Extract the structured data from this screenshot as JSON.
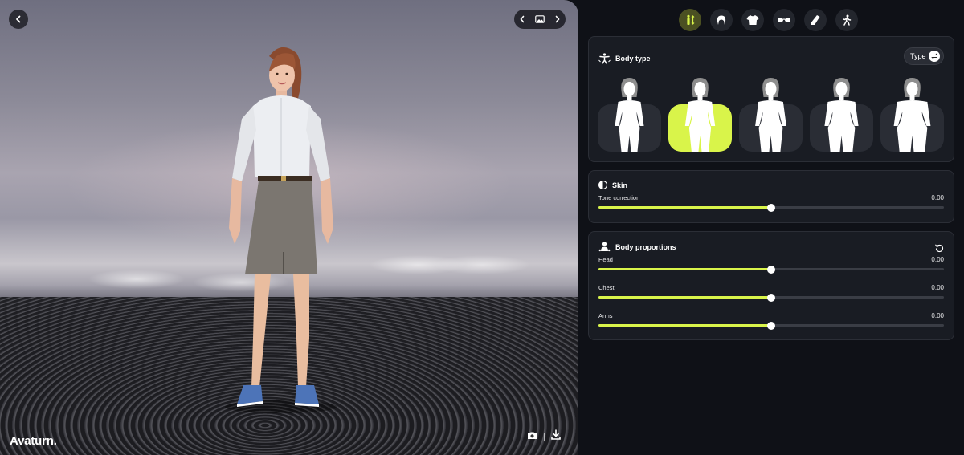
{
  "brand": {
    "logo": "Avaturn."
  },
  "viewport": {
    "icons": {
      "back": "chevron-left-icon",
      "prev": "chevron-left-icon",
      "background": "image-icon",
      "next": "chevron-right-icon",
      "screenshot": "camera-icon",
      "download": "download-icon"
    }
  },
  "tabs": [
    {
      "name": "body",
      "icon": "body-icon",
      "active": true
    },
    {
      "name": "hair",
      "icon": "hair-icon",
      "active": false
    },
    {
      "name": "outfit",
      "icon": "tshirt-icon",
      "active": false
    },
    {
      "name": "glasses",
      "icon": "glasses-icon",
      "active": false
    },
    {
      "name": "shoes",
      "icon": "shoe-icon",
      "active": false
    },
    {
      "name": "animation",
      "icon": "walking-icon",
      "active": false
    }
  ],
  "body_type": {
    "title": "Body type",
    "type_button": "Type",
    "options": [
      {
        "name": "slim",
        "selected": false
      },
      {
        "name": "average",
        "selected": true
      },
      {
        "name": "curvy",
        "selected": false
      },
      {
        "name": "full",
        "selected": false
      },
      {
        "name": "plus",
        "selected": false
      }
    ]
  },
  "skin": {
    "title": "Skin",
    "sliders": [
      {
        "label": "Tone correction",
        "value": "0.00",
        "level": 0.5
      }
    ]
  },
  "body_proportions": {
    "title": "Body proportions",
    "sliders": [
      {
        "label": "Head",
        "value": "0.00",
        "level": 0.5
      },
      {
        "label": "Chest",
        "value": "0.00",
        "level": 0.5
      },
      {
        "label": "Arms",
        "value": "0.00",
        "level": 0.5
      }
    ]
  },
  "colors": {
    "accent": "#d9f44a",
    "panel_bg": "#0f1117",
    "card_bg": "#191c23"
  }
}
